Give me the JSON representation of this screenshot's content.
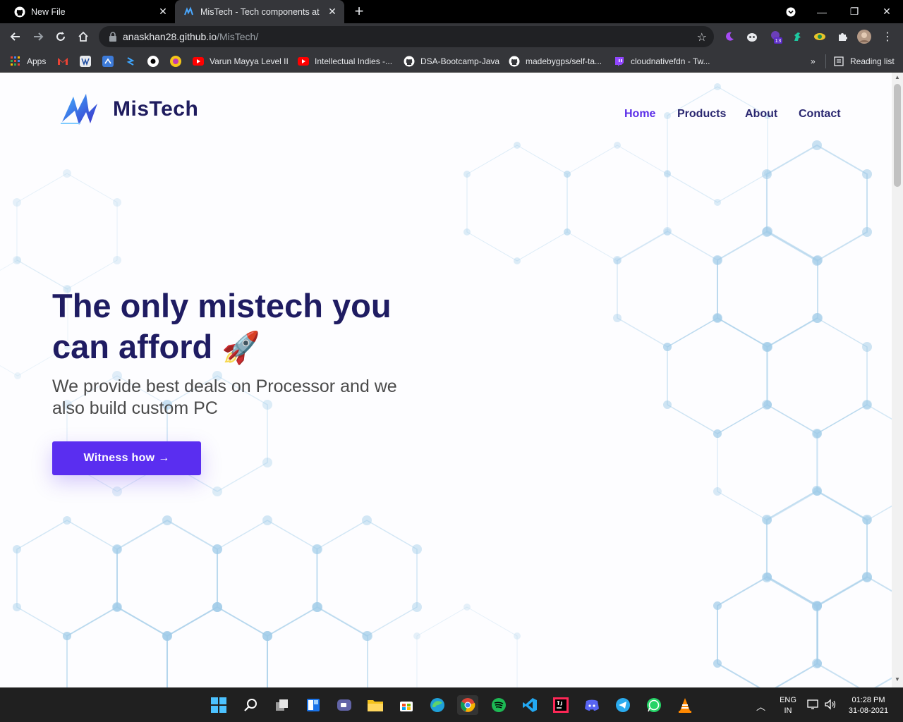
{
  "browser": {
    "tabs": [
      {
        "title": "New File",
        "icon": "github-icon"
      },
      {
        "title": "MisTech - Tech components at it's",
        "icon": "mistech-favicon"
      }
    ],
    "new_tab": "+",
    "url_domain": "anaskhan28.github.io",
    "url_path": "/MisTech/",
    "extension_badge": "13",
    "bookmarks": [
      {
        "label": "Apps",
        "icon": "apps-grid-icon"
      },
      {
        "label": "",
        "icon": "gmail-icon"
      },
      {
        "label": "",
        "icon": "bookmark-icon"
      },
      {
        "label": "",
        "icon": "bookmark-icon"
      },
      {
        "label": "",
        "icon": "bookmark-icon"
      },
      {
        "label": "",
        "icon": "bookmark-icon"
      },
      {
        "label": "",
        "icon": "bookmark-icon"
      },
      {
        "label": "Varun Mayya Level II",
        "icon": "youtube-icon"
      },
      {
        "label": "Intellectual Indies -...",
        "icon": "youtube-icon"
      },
      {
        "label": "DSA-Bootcamp-Java",
        "icon": "github-icon"
      },
      {
        "label": "madebygps/self-ta...",
        "icon": "github-icon"
      },
      {
        "label": "cloudnativefdn - Tw...",
        "icon": "twitch-icon"
      }
    ],
    "overflow": "»",
    "reading_list": "Reading list"
  },
  "site": {
    "brand": "MisTech",
    "nav": [
      "Home",
      "Products",
      "About",
      "Contact"
    ],
    "hero_title": "The only mistech you can afford",
    "hero_emoji": "🚀",
    "hero_sub": "We provide best deals on Processor and we also build custom PC",
    "cta": "Witness how",
    "cta_arrow": "→"
  },
  "taskbar": {
    "lang_line1": "ENG",
    "lang_line2": "IN",
    "time": "01:28 PM",
    "date": "31-08-2021"
  },
  "colors": {
    "accent": "#5a2ef0",
    "brand_text": "#1f1c5e",
    "hex_lines": "#9fcbe8"
  }
}
